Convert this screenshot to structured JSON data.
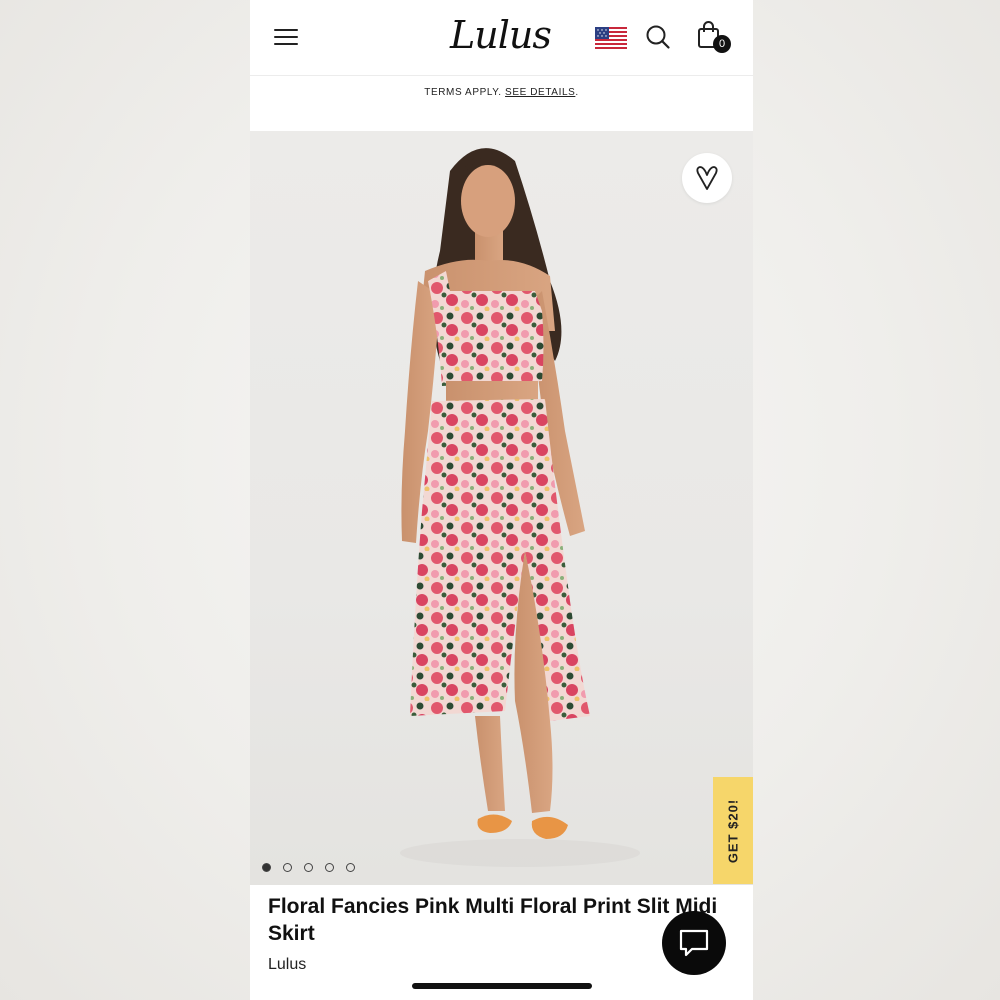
{
  "header": {
    "logo_text": "Lulus",
    "cart_count": "0",
    "icons": [
      "hamburger-menu-icon",
      "us-flag-icon",
      "search-icon",
      "shopping-bag-icon"
    ]
  },
  "promo": {
    "terms_text": "TERMS APPLY.",
    "details_link": "SEE DETAILS"
  },
  "gallery": {
    "image_count": 5,
    "active_index": 1,
    "get_offer_label": "GET $20!"
  },
  "product": {
    "title": "Floral Fancies Pink Multi Floral Print Slit Midi Skirt",
    "brand": "Lulus"
  },
  "colors": {
    "background": "#efeeeb",
    "offer_tab": "#f6d66a",
    "chat_button": "#0a0a0a",
    "skirt_pink": "#e1576c",
    "sandal_orange": "#e89545"
  }
}
